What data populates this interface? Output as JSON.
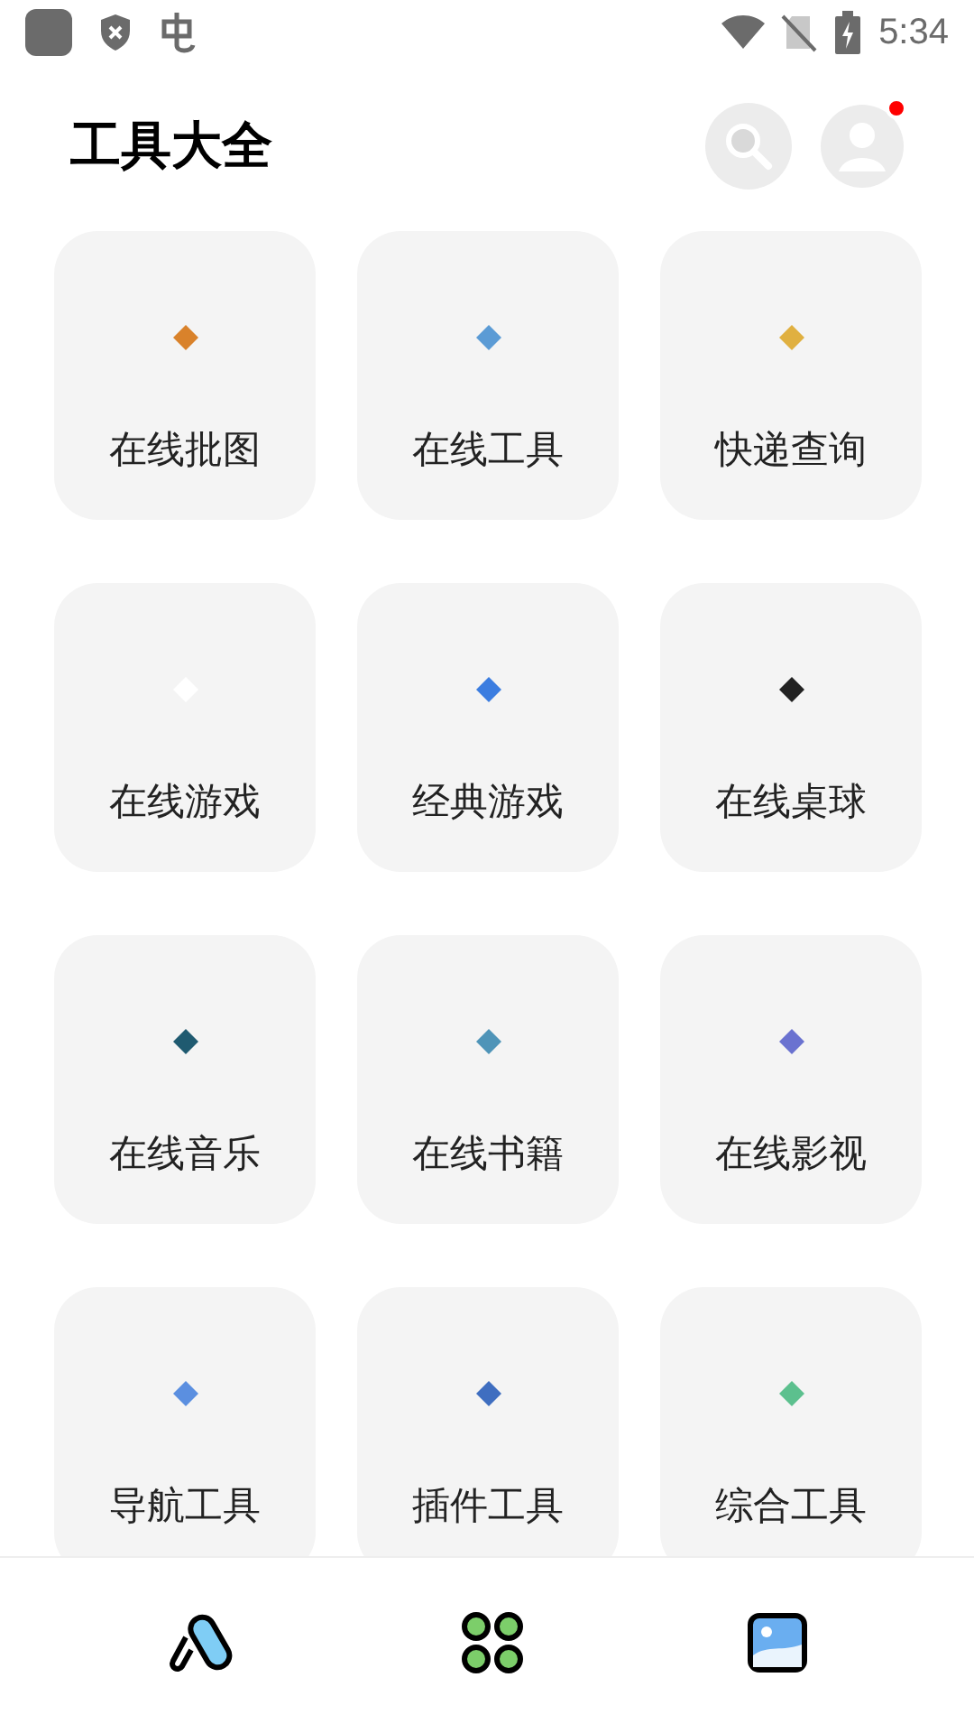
{
  "status_bar": {
    "time": "5:34"
  },
  "header": {
    "title": "工具大全",
    "notification_dot": true
  },
  "tools": [
    {
      "label": "在线批图",
      "color": "#d9822b"
    },
    {
      "label": "在线工具",
      "color": "#5b9bd5"
    },
    {
      "label": "快递查询",
      "color": "#e0b040"
    },
    {
      "label": "在线游戏",
      "color": "#ffffff"
    },
    {
      "label": "经典游戏",
      "color": "#3b7de0"
    },
    {
      "label": "在线桌球",
      "color": "#222222"
    },
    {
      "label": "在线音乐",
      "color": "#1f5a70"
    },
    {
      "label": "在线书籍",
      "color": "#4f94b8"
    },
    {
      "label": "在线影视",
      "color": "#6a72d0"
    },
    {
      "label": "导航工具",
      "color": "#5b8fe0"
    },
    {
      "label": "插件工具",
      "color": "#3f6ec0"
    },
    {
      "label": "综合工具",
      "color": "#5cc08e"
    }
  ]
}
